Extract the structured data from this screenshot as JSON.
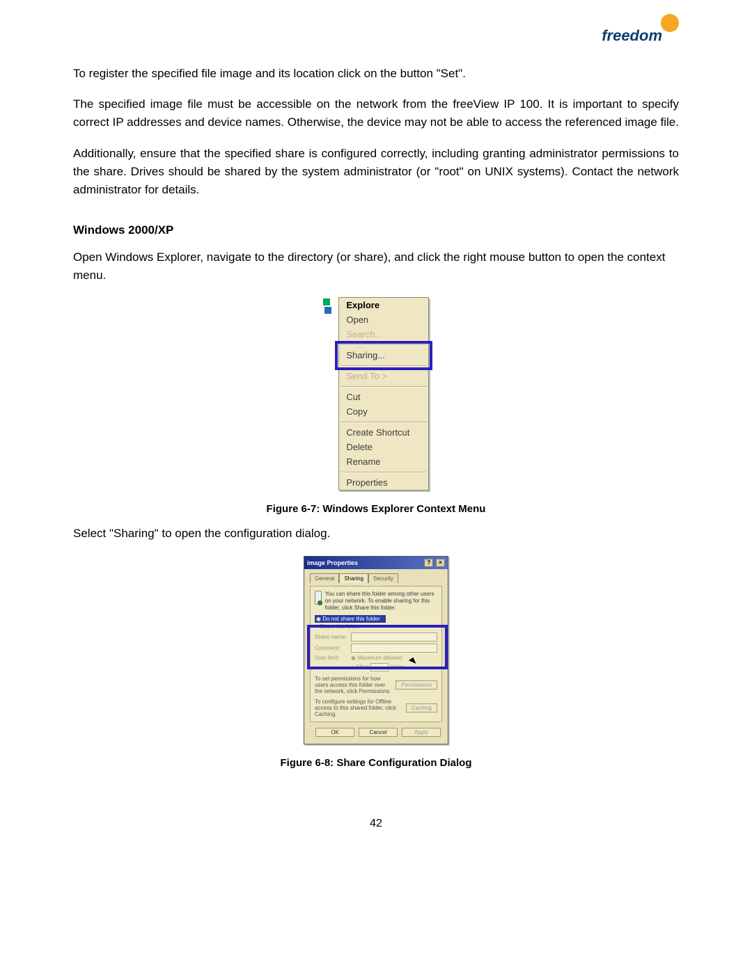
{
  "logo": {
    "text": "freedom"
  },
  "paragraphs": {
    "p1": "To register the specified file image and its location click on the button \"Set\".",
    "p2": "The specified image file must be accessible on the network from the freeView IP 100. It is important to specify correct IP addresses and device names. Otherwise, the device may not be able to access the referenced image file.",
    "p3": "Additionally, ensure that the specified share is configured correctly, including granting administrator permissions to the share. Drives should be shared by the system administrator (or \"root\" on UNIX systems). Contact the network administrator for details.",
    "section_title": "Windows 2000/XP",
    "p4": "Open Windows Explorer, navigate to the directory (or share), and click the right mouse button to open the context menu.",
    "p5": "Select \"Sharing\" to open the configuration dialog."
  },
  "context_menu": {
    "items": {
      "explore": "Explore",
      "open": "Open",
      "search": "Search...",
      "sharing": "Sharing...",
      "sendto": "Send To   >",
      "cut": "Cut",
      "copy": "Copy",
      "shortcut": "Create Shortcut",
      "delete": "Delete",
      "rename": "Rename",
      "properties": "Properties"
    }
  },
  "caption1": "Figure 6-7: Windows Explorer Context Menu",
  "dialog": {
    "title": "image Properties",
    "tabs": {
      "general": "General",
      "sharing": "Sharing",
      "security": "Security"
    },
    "desc": "You can share this folder among other users on your network. To enable sharing for this folder, click Share this folder.",
    "opt_noshare": "Do not share this folder",
    "opt_share": "Share this folder",
    "label_sharename": "Share name:",
    "label_comment": "Comment:",
    "label_userlimit": "User limit:",
    "opt_max": "Maximum allowed",
    "opt_allow": "Allow",
    "users": "Users",
    "perm_text": "To set permissions for how users access this folder over the network, click Permissions.",
    "perm_btn": "Permissions",
    "cache_text": "To configure settings for Offline access to this shared folder, click Caching.",
    "cache_btn": "Caching",
    "ok": "OK",
    "cancel": "Cancel",
    "apply": "Apply"
  },
  "caption2": "Figure 6-8: Share Configuration Dialog",
  "page_number": "42"
}
